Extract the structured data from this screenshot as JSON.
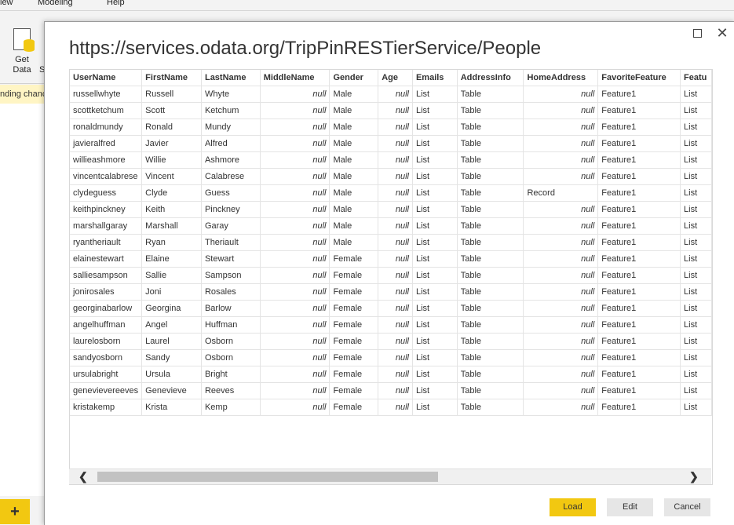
{
  "background": {
    "menu": [
      "iew",
      "Modeling",
      "Help"
    ],
    "get_data_label_1": "Get",
    "get_data_label_2": "Data",
    "s_label": "S",
    "banner_text": "nding chanc",
    "add_page": "+"
  },
  "dialog": {
    "title": "https://services.odata.org/TripPinRESTierService/People",
    "buttons": {
      "load": "Load",
      "edit": "Edit",
      "cancel": "Cancel"
    },
    "scroll": {
      "left": "❮",
      "right": "❯"
    },
    "table": {
      "columns": [
        "UserName",
        "FirstName",
        "LastName",
        "MiddleName",
        "Gender",
        "Age",
        "Emails",
        "AddressInfo",
        "HomeAddress",
        "FavoriteFeature",
        "Featu"
      ],
      "rows": [
        [
          "russellwhyte",
          "Russell",
          "Whyte",
          "null",
          "Male",
          "null",
          "List",
          "Table",
          "null",
          "Feature1",
          "List"
        ],
        [
          "scottketchum",
          "Scott",
          "Ketchum",
          "null",
          "Male",
          "null",
          "List",
          "Table",
          "null",
          "Feature1",
          "List"
        ],
        [
          "ronaldmundy",
          "Ronald",
          "Mundy",
          "null",
          "Male",
          "null",
          "List",
          "Table",
          "null",
          "Feature1",
          "List"
        ],
        [
          "javieralfred",
          "Javier",
          "Alfred",
          "null",
          "Male",
          "null",
          "List",
          "Table",
          "null",
          "Feature1",
          "List"
        ],
        [
          "willieashmore",
          "Willie",
          "Ashmore",
          "null",
          "Male",
          "null",
          "List",
          "Table",
          "null",
          "Feature1",
          "List"
        ],
        [
          "vincentcalabrese",
          "Vincent",
          "Calabrese",
          "null",
          "Male",
          "null",
          "List",
          "Table",
          "null",
          "Feature1",
          "List"
        ],
        [
          "clydeguess",
          "Clyde",
          "Guess",
          "null",
          "Male",
          "null",
          "List",
          "Table",
          "Record",
          "Feature1",
          "List"
        ],
        [
          "keithpinckney",
          "Keith",
          "Pinckney",
          "null",
          "Male",
          "null",
          "List",
          "Table",
          "null",
          "Feature1",
          "List"
        ],
        [
          "marshallgaray",
          "Marshall",
          "Garay",
          "null",
          "Male",
          "null",
          "List",
          "Table",
          "null",
          "Feature1",
          "List"
        ],
        [
          "ryantheriault",
          "Ryan",
          "Theriault",
          "null",
          "Male",
          "null",
          "List",
          "Table",
          "null",
          "Feature1",
          "List"
        ],
        [
          "elainestewart",
          "Elaine",
          "Stewart",
          "null",
          "Female",
          "null",
          "List",
          "Table",
          "null",
          "Feature1",
          "List"
        ],
        [
          "salliesampson",
          "Sallie",
          "Sampson",
          "null",
          "Female",
          "null",
          "List",
          "Table",
          "null",
          "Feature1",
          "List"
        ],
        [
          "jonirosales",
          "Joni",
          "Rosales",
          "null",
          "Female",
          "null",
          "List",
          "Table",
          "null",
          "Feature1",
          "List"
        ],
        [
          "georginabarlow",
          "Georgina",
          "Barlow",
          "null",
          "Female",
          "null",
          "List",
          "Table",
          "null",
          "Feature1",
          "List"
        ],
        [
          "angelhuffman",
          "Angel",
          "Huffman",
          "null",
          "Female",
          "null",
          "List",
          "Table",
          "null",
          "Feature1",
          "List"
        ],
        [
          "laurelosborn",
          "Laurel",
          "Osborn",
          "null",
          "Female",
          "null",
          "List",
          "Table",
          "null",
          "Feature1",
          "List"
        ],
        [
          "sandyosborn",
          "Sandy",
          "Osborn",
          "null",
          "Female",
          "null",
          "List",
          "Table",
          "null",
          "Feature1",
          "List"
        ],
        [
          "ursulabright",
          "Ursula",
          "Bright",
          "null",
          "Female",
          "null",
          "List",
          "Table",
          "null",
          "Feature1",
          "List"
        ],
        [
          "genevievereeves",
          "Genevieve",
          "Reeves",
          "null",
          "Female",
          "null",
          "List",
          "Table",
          "null",
          "Feature1",
          "List"
        ],
        [
          "kristakemp",
          "Krista",
          "Kemp",
          "null",
          "Female",
          "null",
          "List",
          "Table",
          "null",
          "Feature1",
          "List"
        ]
      ]
    }
  },
  "colors": {
    "accent": "#f2c811",
    "grid_line": "#e4e4e4",
    "text": "#333333"
  }
}
